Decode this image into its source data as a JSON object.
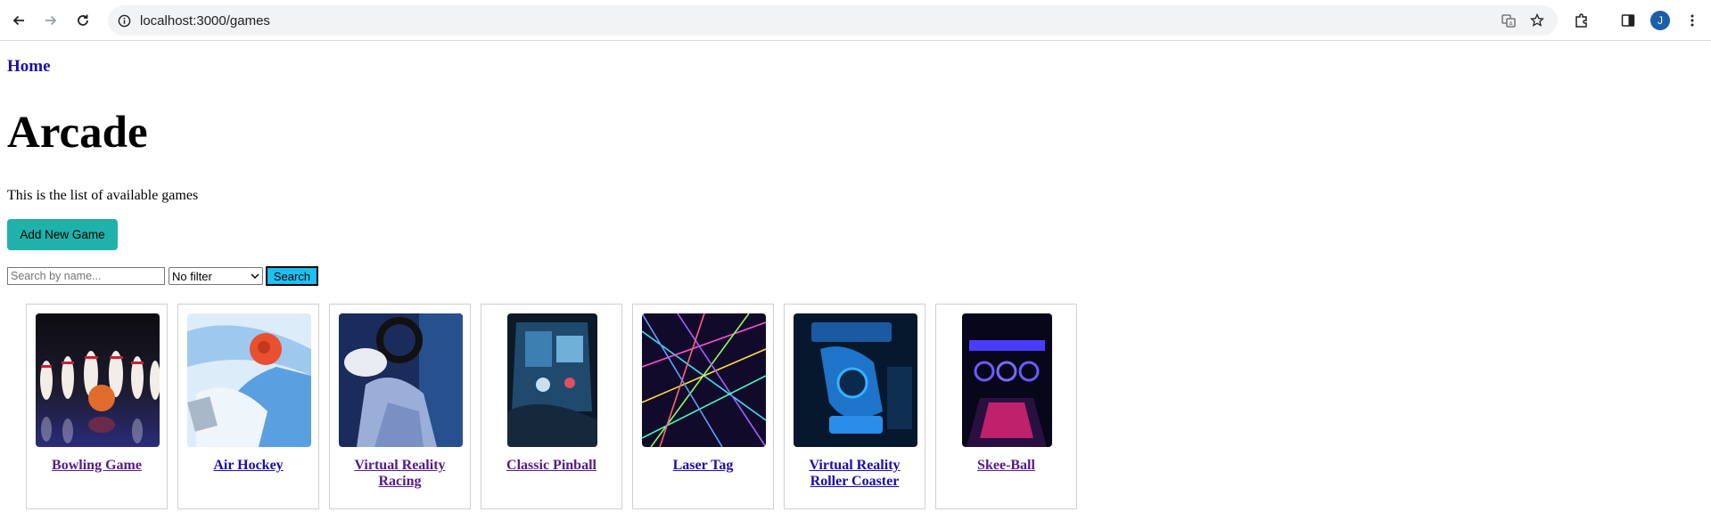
{
  "browser": {
    "url": "localhost:3000/games",
    "avatar_letter": "J"
  },
  "nav": {
    "home_label": "Home"
  },
  "page": {
    "title": "Arcade",
    "description": "This is the list of available games",
    "add_button_label": "Add New Game"
  },
  "search": {
    "placeholder": "Search by name...",
    "filter_selected": "No filter",
    "button_label": "Search"
  },
  "games": [
    {
      "name": "Bowling Game",
      "visited": true
    },
    {
      "name": "Air Hockey",
      "visited": false
    },
    {
      "name": "Virtual Reality Racing",
      "visited": true
    },
    {
      "name": "Classic Pinball",
      "visited": true
    },
    {
      "name": "Laser Tag",
      "visited": false
    },
    {
      "name": "Virtual Reality Roller Coaster",
      "visited": false
    },
    {
      "name": "Skee-Ball",
      "visited": true
    }
  ],
  "colors": {
    "add_button": "#20b2aa",
    "search_button": "#1ec0f0",
    "link": "#1a0dab",
    "visited_link": "#551a8b"
  }
}
